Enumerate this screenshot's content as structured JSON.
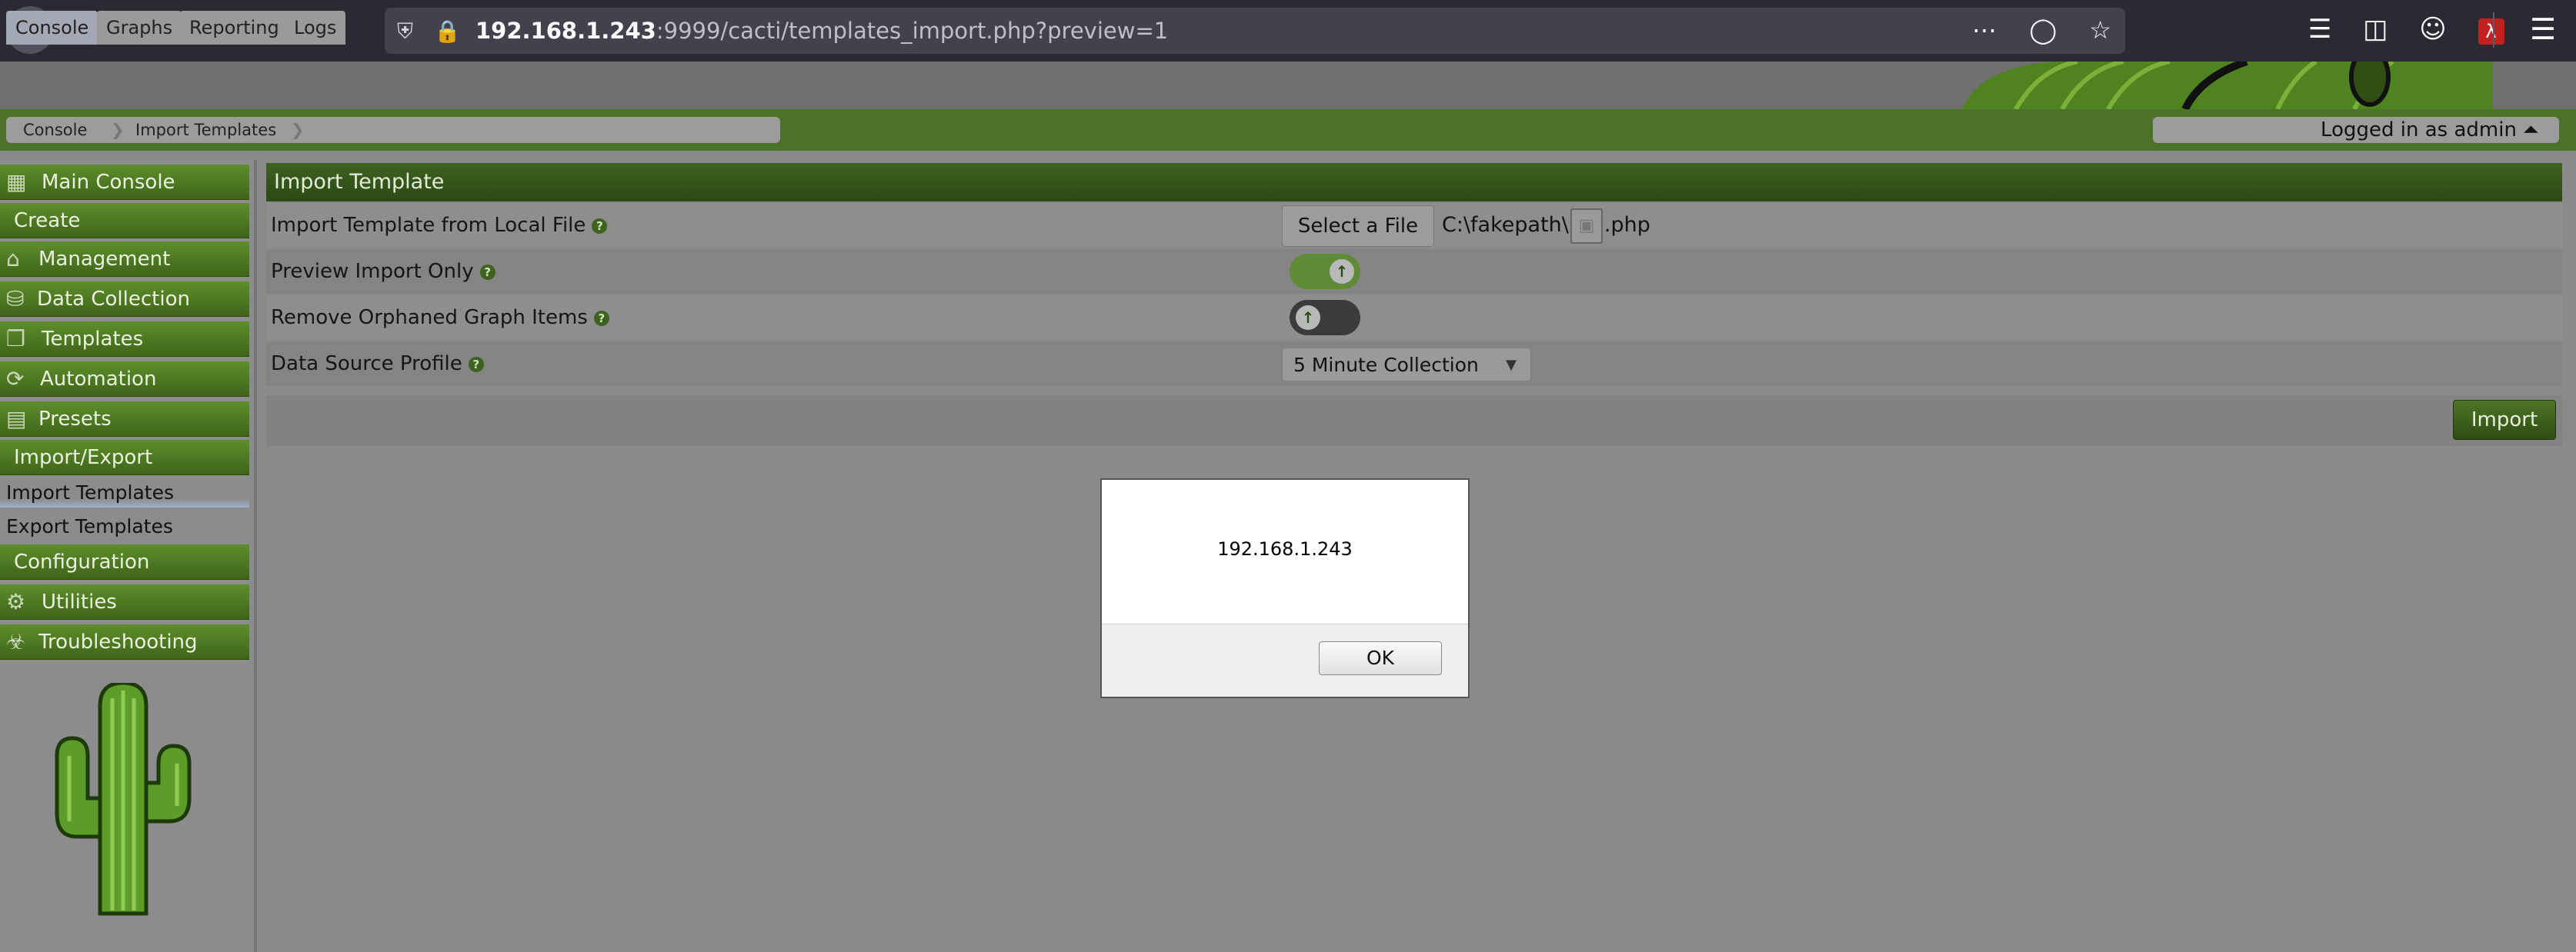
{
  "browser": {
    "url_host": "192.168.1.243",
    "url_rest": ":9999/cacti/templates_import.php?preview=1"
  },
  "tabs": [
    {
      "label": "Console"
    },
    {
      "label": "Graphs"
    },
    {
      "label": "Reporting"
    },
    {
      "label": "Logs"
    }
  ],
  "breadcrumb": [
    "Console",
    "Import Templates"
  ],
  "user": {
    "login_text": "Logged in as admin ⏶"
  },
  "sidebar": {
    "main_console": "Main Console",
    "create": "Create",
    "management": "Management",
    "data_collection": "Data Collection",
    "templates": "Templates",
    "automation": "Automation",
    "presets": "Presets",
    "import_export": "Import/Export",
    "import_templates": "Import Templates",
    "export_templates": "Export Templates",
    "configuration": "Configuration",
    "utilities": "Utilities",
    "troubleshooting": "Troubleshooting"
  },
  "panel": {
    "title": "Import Template",
    "import_file_label": "Import Template from Local File",
    "select_file_label": "Select a File",
    "file_prefix": "C:\\fakepath\\",
    "file_suffix": ".php",
    "preview_label": "Preview Import Only",
    "preview_on": true,
    "orphan_label": "Remove Orphaned Graph Items",
    "orphan_on": false,
    "profile_label": "Data Source Profile",
    "profile_value": "5 Minute Collection",
    "import_button": "Import"
  },
  "dialog": {
    "message": "192.168.1.243",
    "ok": "OK"
  }
}
